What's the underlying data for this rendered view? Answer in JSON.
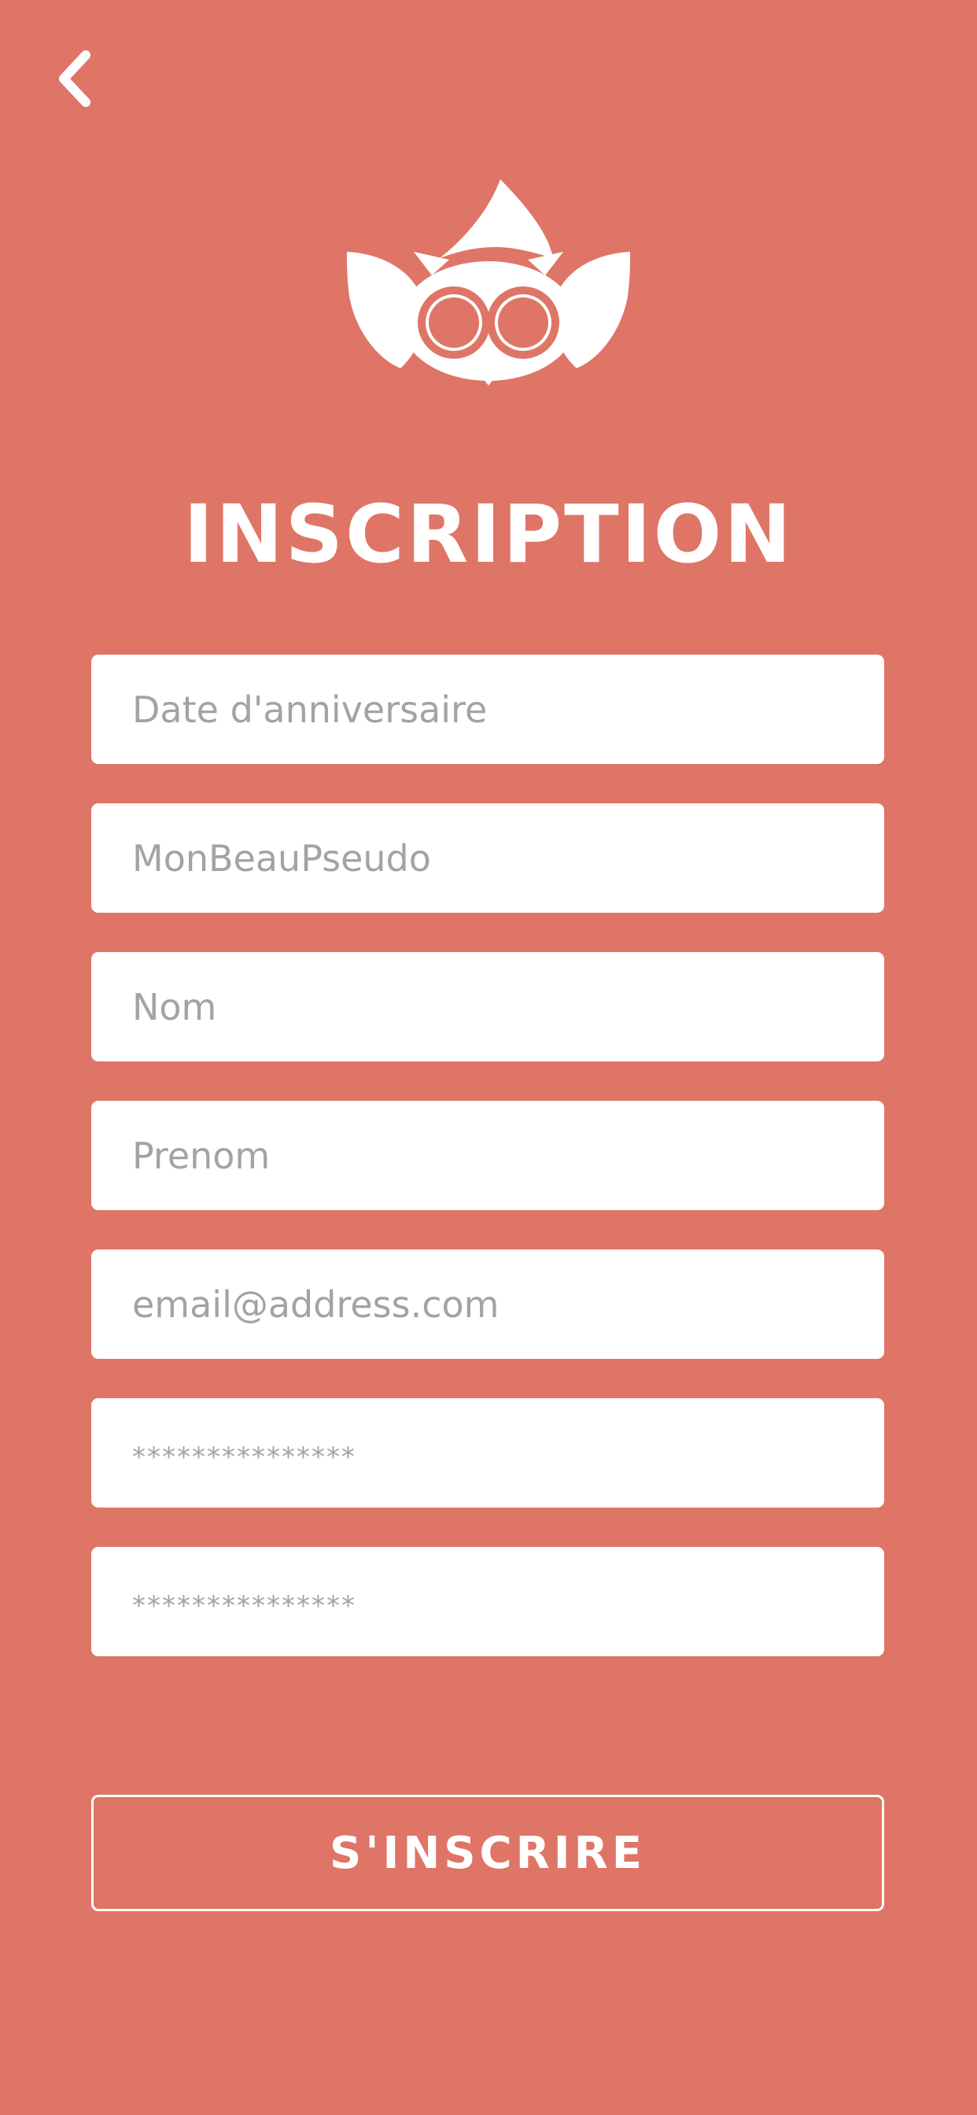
{
  "header": {
    "back_icon": "chevron-left-icon",
    "logo_icon": "owl-logo-icon"
  },
  "title": "INSCRIPTION",
  "form": {
    "fields": [
      {
        "type": "text",
        "placeholder": "Date d'anniversaire",
        "value": ""
      },
      {
        "type": "text",
        "placeholder": "MonBeauPseudo",
        "value": ""
      },
      {
        "type": "text",
        "placeholder": "Nom",
        "value": ""
      },
      {
        "type": "text",
        "placeholder": "Prenom",
        "value": ""
      },
      {
        "type": "email",
        "placeholder": "email@address.com",
        "value": ""
      },
      {
        "type": "password",
        "placeholder": "***************",
        "value": ""
      },
      {
        "type": "password",
        "placeholder": "***************",
        "value": ""
      }
    ]
  },
  "submit_label": "S'INSCRIRE",
  "colors": {
    "background": "#df7566",
    "foreground": "#ffffff",
    "placeholder": "#a3a3a3"
  }
}
